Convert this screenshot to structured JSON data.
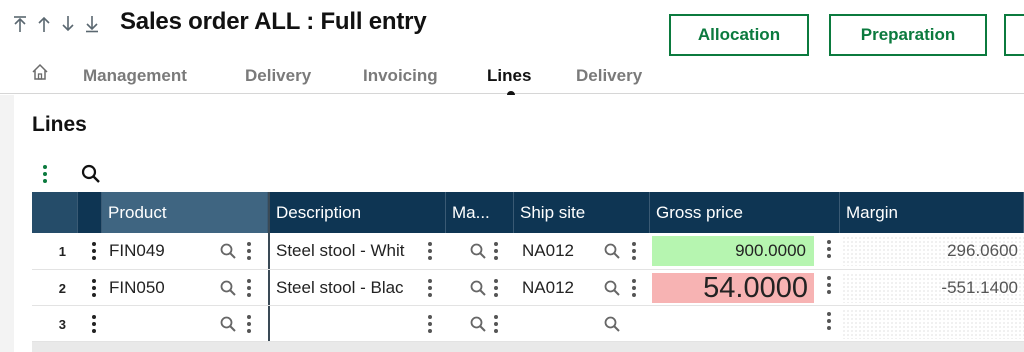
{
  "header": {
    "title": "Sales order ALL : Full entry",
    "nav_icons": [
      "first-record-icon",
      "previous-record-icon",
      "next-record-icon",
      "last-record-icon"
    ],
    "buttons": {
      "allocation": "Allocation",
      "preparation": "Preparation"
    }
  },
  "tabs": {
    "items": [
      "Management",
      "Delivery",
      "Invoicing",
      "Lines",
      "Delivery"
    ],
    "active": "Lines"
  },
  "section": {
    "title": "Lines"
  },
  "grid": {
    "columns": [
      "Product",
      "Description",
      "Ma...",
      "Ship site",
      "Gross price",
      "Margin"
    ],
    "rows": [
      {
        "num": "1",
        "product": "FIN049",
        "description": "Steel stool - Whit",
        "ship_site": "NA012",
        "gross_price": "900.0000",
        "margin": "296.0600"
      },
      {
        "num": "2",
        "product": "FIN050",
        "description": "Steel stool - Blac",
        "ship_site": "NA012",
        "gross_price": "54.0000",
        "margin": "-551.1400"
      },
      {
        "num": "3",
        "product": "",
        "description": "",
        "ship_site": "",
        "gross_price": "",
        "margin": ""
      }
    ]
  },
  "colors": {
    "accent": "#0b7a3e",
    "header_bg": "#0e3553",
    "header_active_col": "#3f6581",
    "gross_ok": "#b6f5b0",
    "gross_alert": "#f7b3b3"
  }
}
